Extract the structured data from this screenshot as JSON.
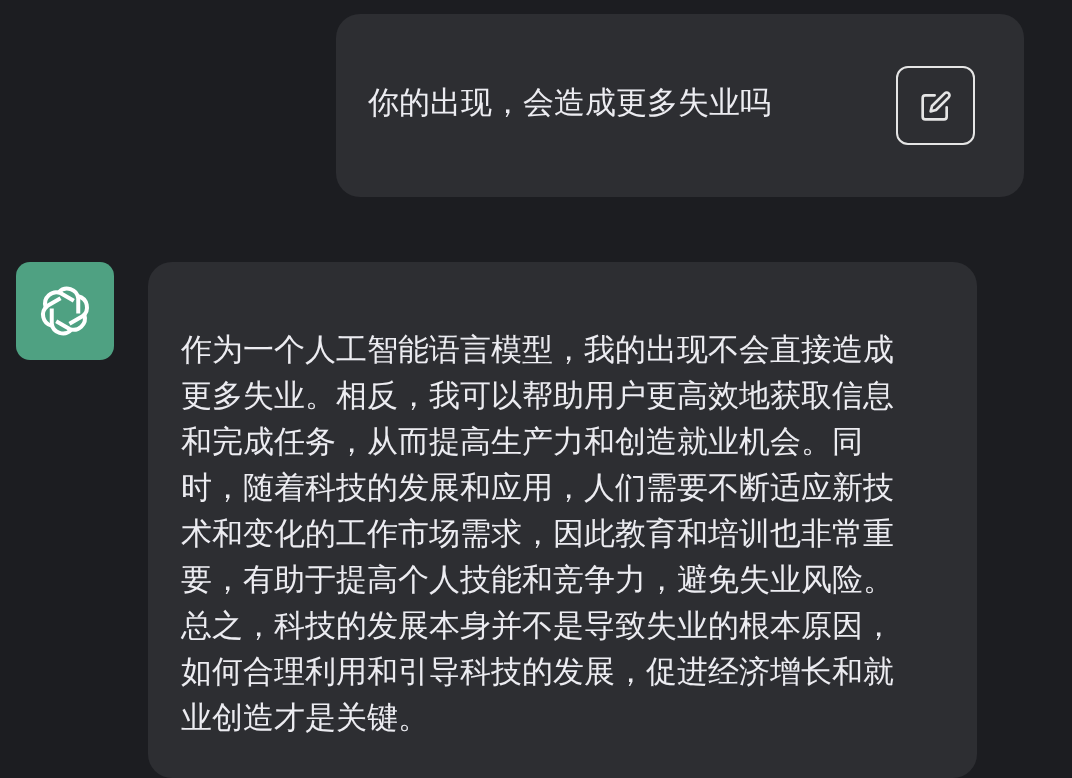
{
  "messages": [
    {
      "kind": "user",
      "text": "你的出现，会造成更多失业吗"
    },
    {
      "kind": "assistant",
      "text": "作为一个人工智能语言模型，我的出现不会直接造成更多失业。相反，我可以帮助用户更高效地获取信息和完成任务，从而提高生产力和创造就业机会。同时，随着科技的发展和应用，人们需要不断适应新技术和变化的工作市场需求，因此教育和培训也非常重要，有助于提高个人技能和竞争力，避免失业风险。总之，科技的发展本身并不是导致失业的根本原因，如何合理利用和引导科技的发展，促进经济增长和就业创造才是关键。"
    }
  ]
}
